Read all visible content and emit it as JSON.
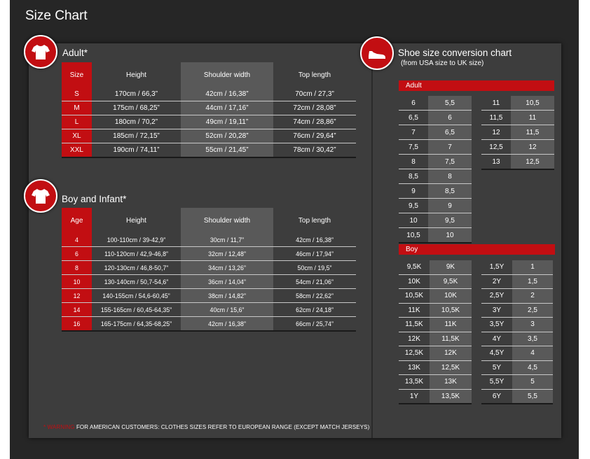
{
  "page": {
    "title": "Size Chart"
  },
  "adult": {
    "heading": "Adult*",
    "headers": [
      "Size",
      "Height",
      "Shoulder width",
      "Top length"
    ],
    "rows": [
      [
        "S",
        "170cm / 66,3”",
        "42cm / 16,38”",
        "70cm / 27,3”"
      ],
      [
        "M",
        "175cm / 68,25”",
        "44cm / 17,16”",
        "72cm / 28,08”"
      ],
      [
        "L",
        "180cm / 70,2”",
        "49cm / 19,11”",
        "74cm / 28,86”"
      ],
      [
        "XL",
        "185cm / 72,15”",
        "52cm / 20,28”",
        "76cm / 29,64”"
      ],
      [
        "XXL",
        "190cm / 74,11”",
        "55cm / 21,45”",
        "78cm / 30,42”"
      ]
    ]
  },
  "boy_infant": {
    "heading": "Boy and Infant*",
    "headers": [
      "Age",
      "Height",
      "Shoulder width",
      "Top length"
    ],
    "rows": [
      [
        "4",
        "100-110cm / 39-42,9”",
        "30cm / 11,7”",
        "42cm / 16,38”"
      ],
      [
        "6",
        "110-120cm / 42,9-46,8”",
        "32cm / 12,48”",
        "46cm / 17,94”"
      ],
      [
        "8",
        "120-130cm / 46,8-50,7”",
        "34cm / 13,26”",
        "50cm / 19,5”"
      ],
      [
        "10",
        "130-140cm / 50,7-54,6”",
        "36cm / 14,04”",
        "54cm / 21,06”"
      ],
      [
        "12",
        "140-155cm / 54,6-60,45”",
        "38cm / 14,82”",
        "58cm / 22,62”"
      ],
      [
        "14",
        "155-165cm / 60,45-64,35”",
        "40cm / 15,6”",
        "62cm / 24,18”"
      ],
      [
        "16",
        "165-175cm / 64,35-68,25”",
        "42cm / 16,38”",
        "66cm / 25,74”"
      ]
    ]
  },
  "shoe": {
    "heading": "Shoe size conversion chart",
    "subheading": "(from USA size to UK size)",
    "adult": {
      "label": "Adult",
      "col1": [
        [
          "6",
          "5,5"
        ],
        [
          "6,5",
          "6"
        ],
        [
          "7",
          "6,5"
        ],
        [
          "7,5",
          "7"
        ],
        [
          "8",
          "7,5"
        ],
        [
          "8,5",
          "8"
        ],
        [
          "9",
          "8,5"
        ],
        [
          "9,5",
          "9"
        ],
        [
          "10",
          "9,5"
        ],
        [
          "10,5",
          "10"
        ]
      ],
      "col2": [
        [
          "11",
          "10,5"
        ],
        [
          "11,5",
          "11"
        ],
        [
          "12",
          "11,5"
        ],
        [
          "12,5",
          "12"
        ],
        [
          "13",
          "12,5"
        ]
      ]
    },
    "boy": {
      "label": "Boy",
      "col1": [
        [
          "9,5K",
          "9K"
        ],
        [
          "10K",
          "9,5K"
        ],
        [
          "10,5K",
          "10K"
        ],
        [
          "11K",
          "10,5K"
        ],
        [
          "11,5K",
          "11K"
        ],
        [
          "12K",
          "11,5K"
        ],
        [
          "12,5K",
          "12K"
        ],
        [
          "13K",
          "12,5K"
        ],
        [
          "13,5K",
          "13K"
        ],
        [
          "1Y",
          "13,5K"
        ]
      ],
      "col2": [
        [
          "1,5Y",
          "1"
        ],
        [
          "2Y",
          "1,5"
        ],
        [
          "2,5Y",
          "2"
        ],
        [
          "3Y",
          "2,5"
        ],
        [
          "3,5Y",
          "3"
        ],
        [
          "4Y",
          "3,5"
        ],
        [
          "4,5Y",
          "4"
        ],
        [
          "5Y",
          "4,5"
        ],
        [
          "5,5Y",
          "5"
        ],
        [
          "6Y",
          "5,5"
        ]
      ]
    }
  },
  "footnote": {
    "marker": "*",
    "red_text": "WARNING",
    "text": " FOR AMERICAN CUSTOMERS: CLOTHES SIZES REFER TO EUROPEAN RANGE (EXCEPT MATCH JERSEYS)"
  },
  "icons": {
    "shirt": "tshirt-icon",
    "shoe": "shoe-icon"
  },
  "colors": {
    "accent_red": "#c20e12",
    "panel": "#3d3d3d",
    "cell_gray": "#595959",
    "background": "#262626"
  }
}
